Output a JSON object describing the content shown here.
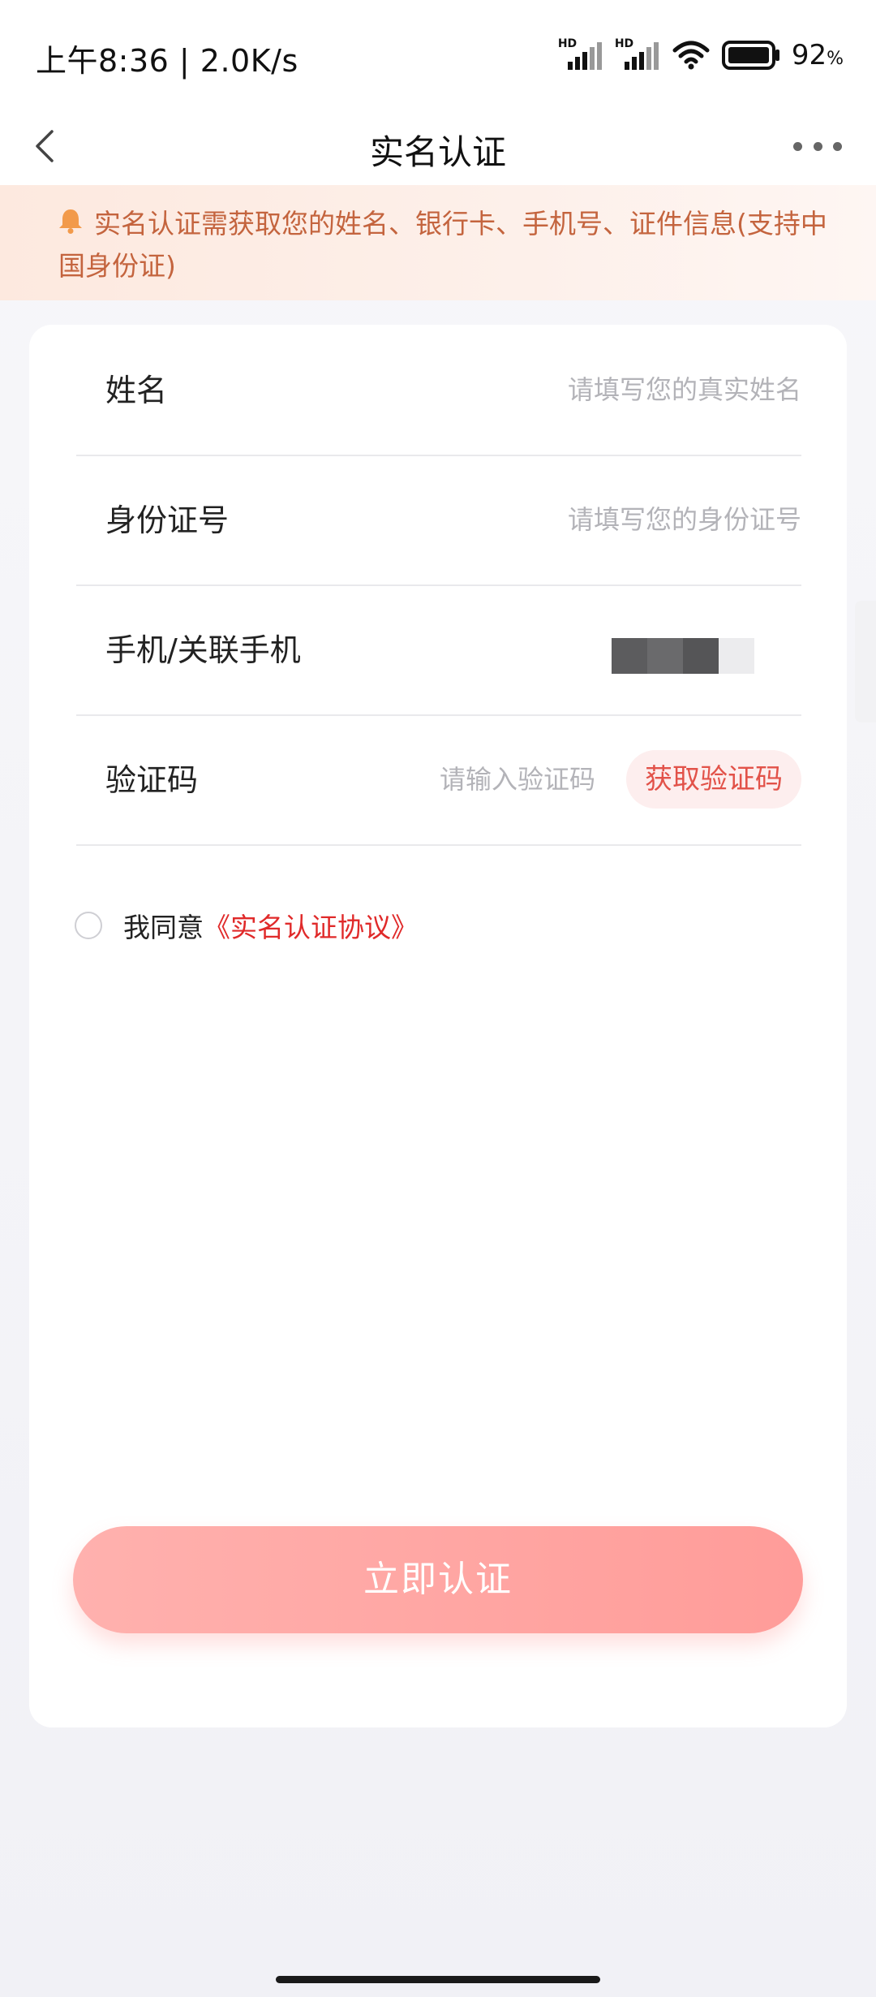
{
  "status_bar": {
    "time": "上午8:36 | 2.0K/s",
    "signal1_label": "HD",
    "signal2_label": "HD",
    "battery_percent": "92",
    "battery_unit": "%"
  },
  "nav": {
    "title": "实名认证"
  },
  "notice": {
    "text": "实名认证需获取您的姓名、银行卡、手机号、证件信息(支持中国身份证)",
    "icon": "bell-icon"
  },
  "form": {
    "name": {
      "label": "姓名",
      "placeholder": "请填写您的真实姓名"
    },
    "id_number": {
      "label": "身份证号",
      "placeholder": "请填写您的身份证号"
    },
    "phone": {
      "label": "手机/关联手机"
    },
    "code": {
      "label": "验证码",
      "placeholder": "请输入验证码",
      "button_label": "获取验证码"
    }
  },
  "agreement": {
    "prefix": "我同意",
    "link": "《实名认证协议》"
  },
  "submit": {
    "label": "立即认证"
  },
  "colors": {
    "accent_red": "#e02a2a",
    "button_pink": "#ff9c99",
    "notice_text": "#c4643e"
  }
}
